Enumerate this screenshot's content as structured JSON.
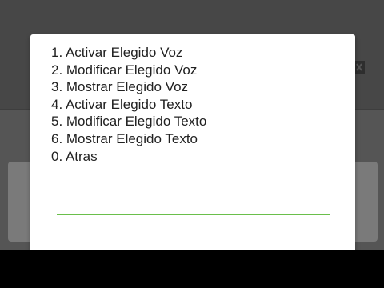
{
  "menu": {
    "items": [
      "1. Activar Elegido Voz",
      "2. Modificar Elegido Voz",
      "3. Mostrar Elegido Voz",
      "4. Activar Elegido Texto",
      "5. Modificar Elegido Texto",
      "6. Mostrar Elegido Texto",
      "0. Atras"
    ]
  },
  "input": {
    "value": "",
    "underline_color": "#6abf4b"
  },
  "icons": {
    "background_right": "backspace-icon"
  }
}
